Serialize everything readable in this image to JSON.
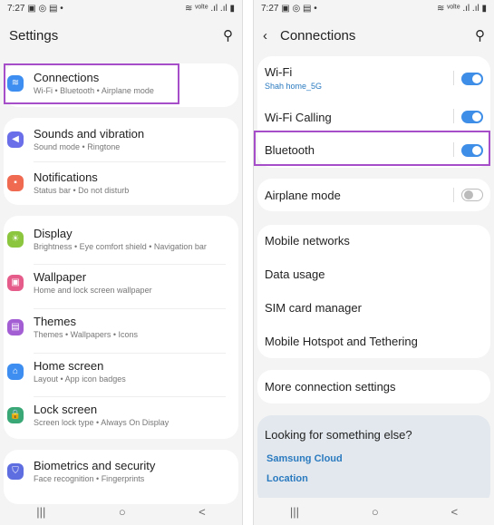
{
  "left": {
    "status": {
      "time": "7:27",
      "icons": "▣ ◎ ▤ •",
      "right_icons": "≋ ᵛᵒˡᵗᵉ .ıl .ıl ▮"
    },
    "title": "Settings",
    "items": [
      {
        "label": "Connections",
        "sub": "Wi-Fi  •  Bluetooth  •  Airplane mode",
        "icon": "wifi-icon",
        "color": "#3d8ef0"
      },
      {
        "label": "Sounds and vibration",
        "sub": "Sound mode  •  Ringtone",
        "icon": "speaker-icon",
        "color": "#6a6ee8"
      },
      {
        "label": "Notifications",
        "sub": "Status bar  •  Do not disturb",
        "icon": "notification-icon",
        "color": "#ef6a50"
      },
      {
        "label": "Display",
        "sub": "Brightness  •  Eye comfort shield  •  Navigation bar",
        "icon": "sun-icon",
        "color": "#8cc63e"
      },
      {
        "label": "Wallpaper",
        "sub": "Home and lock screen wallpaper",
        "icon": "image-icon",
        "color": "#e55c8a"
      },
      {
        "label": "Themes",
        "sub": "Themes  •  Wallpapers  •  Icons",
        "icon": "themes-icon",
        "color": "#a35ed4"
      },
      {
        "label": "Home screen",
        "sub": "Layout  •  App icon badges",
        "icon": "home-icon",
        "color": "#3d8ef0"
      },
      {
        "label": "Lock screen",
        "sub": "Screen lock type  •  Always On Display",
        "icon": "lock-icon",
        "color": "#3aa776"
      },
      {
        "label": "Biometrics and security",
        "sub": "Face recognition  •  Fingerprints",
        "icon": "shield-icon",
        "color": "#5e6de0"
      }
    ]
  },
  "right": {
    "status": {
      "time": "7:27",
      "icons": "▣ ◎ ▤ •",
      "right_icons": "≋ ᵛᵒˡᵗᵉ .ıl .ıl ▮"
    },
    "title": "Connections",
    "wifi": {
      "label": "Wi-Fi",
      "sub": "Shah home_5G",
      "on": true
    },
    "wifi_calling": {
      "label": "Wi-Fi Calling",
      "on": true
    },
    "bluetooth": {
      "label": "Bluetooth",
      "on": true
    },
    "airplane": {
      "label": "Airplane mode",
      "on": false
    },
    "items": [
      "Mobile networks",
      "Data usage",
      "SIM card manager",
      "Mobile Hotspot and Tethering"
    ],
    "more": "More connection settings",
    "looking": {
      "title": "Looking for something else?",
      "links": [
        "Samsung Cloud",
        "Location"
      ]
    }
  },
  "nav": {
    "recent": "|||",
    "home": "○",
    "back": "<"
  }
}
